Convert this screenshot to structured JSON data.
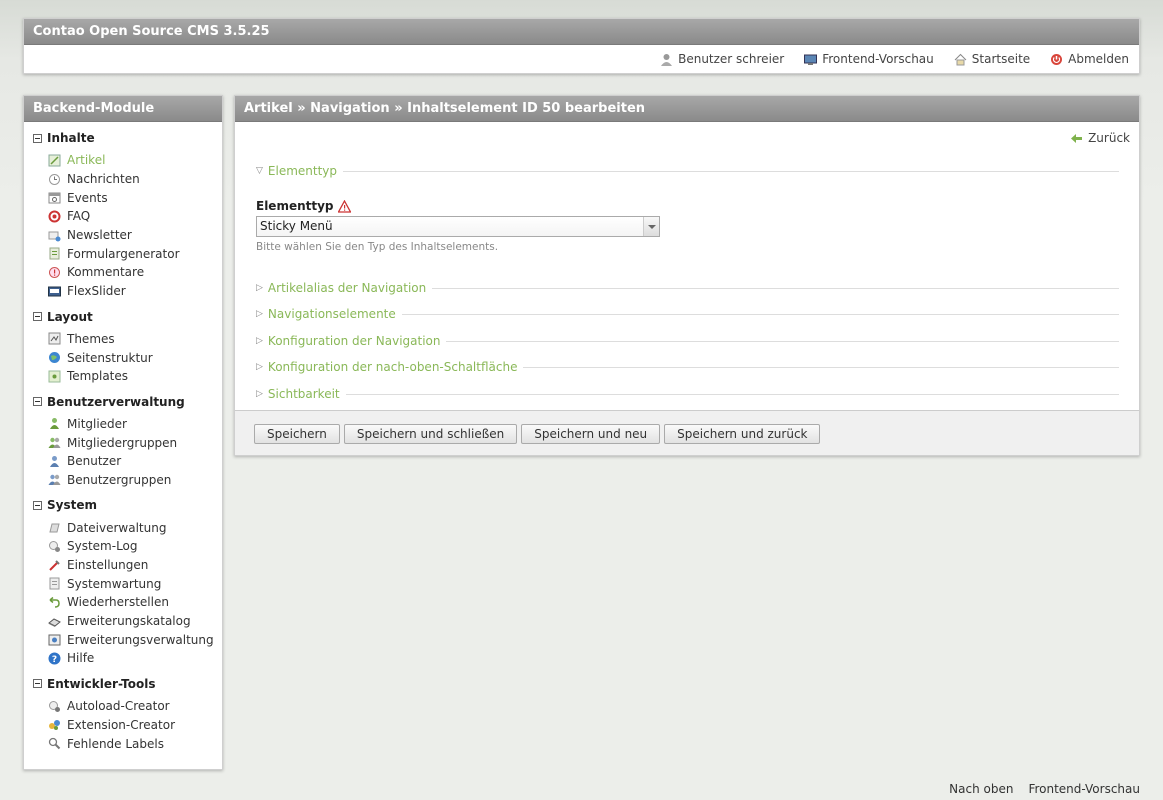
{
  "header": {
    "title": "Contao Open Source CMS 3.5.25",
    "nav": [
      {
        "label": "Benutzer schreier",
        "icon": "user-icon"
      },
      {
        "label": "Frontend-Vorschau",
        "icon": "monitor-icon"
      },
      {
        "label": "Startseite",
        "icon": "home-icon"
      },
      {
        "label": "Abmelden",
        "icon": "logout-icon"
      }
    ]
  },
  "sidebar": {
    "title": "Backend-Module",
    "groups": [
      {
        "title": "Inhalte",
        "items": [
          {
            "label": "Artikel",
            "icon": "article-icon",
            "active": true
          },
          {
            "label": "Nachrichten",
            "icon": "news-icon"
          },
          {
            "label": "Events",
            "icon": "calendar-icon"
          },
          {
            "label": "FAQ",
            "icon": "faq-icon"
          },
          {
            "label": "Newsletter",
            "icon": "newsletter-icon"
          },
          {
            "label": "Formulargenerator",
            "icon": "form-icon"
          },
          {
            "label": "Kommentare",
            "icon": "comment-icon"
          },
          {
            "label": "FlexSlider",
            "icon": "slider-icon"
          }
        ]
      },
      {
        "title": "Layout",
        "items": [
          {
            "label": "Themes",
            "icon": "themes-icon"
          },
          {
            "label": "Seitenstruktur",
            "icon": "globe-icon"
          },
          {
            "label": "Templates",
            "icon": "template-icon"
          }
        ]
      },
      {
        "title": "Benutzerverwaltung",
        "items": [
          {
            "label": "Mitglieder",
            "icon": "member-icon"
          },
          {
            "label": "Mitgliedergruppen",
            "icon": "member-group-icon"
          },
          {
            "label": "Benutzer",
            "icon": "user-icon"
          },
          {
            "label": "Benutzergruppen",
            "icon": "user-group-icon"
          }
        ]
      },
      {
        "title": "System",
        "items": [
          {
            "label": "Dateiverwaltung",
            "icon": "files-icon"
          },
          {
            "label": "System-Log",
            "icon": "log-icon"
          },
          {
            "label": "Einstellungen",
            "icon": "settings-icon"
          },
          {
            "label": "Systemwartung",
            "icon": "maintenance-icon"
          },
          {
            "label": "Wiederherstellen",
            "icon": "undo-icon"
          },
          {
            "label": "Erweiterungskatalog",
            "icon": "catalog-icon"
          },
          {
            "label": "Erweiterungsverwaltung",
            "icon": "extension-icon"
          },
          {
            "label": "Hilfe",
            "icon": "help-icon"
          }
        ]
      },
      {
        "title": "Entwickler-Tools",
        "items": [
          {
            "label": "Autoload-Creator",
            "icon": "autoload-icon"
          },
          {
            "label": "Extension-Creator",
            "icon": "extension-creator-icon"
          },
          {
            "label": "Fehlende Labels",
            "icon": "magnifier-icon"
          }
        ]
      }
    ]
  },
  "main": {
    "breadcrumb": "Artikel » Navigation » Inhaltselement ID 50 bearbeiten",
    "back_label": "Zurück",
    "legend_open": "Elementtyp",
    "field_label": "Elementtyp",
    "select_value": "Sticky Menü",
    "help_text": "Bitte wählen Sie den Typ des Inhaltselements.",
    "legends_closed": [
      "Artikelalias der Navigation",
      "Navigationselemente",
      "Konfiguration der Navigation",
      "Konfiguration der nach-oben-Schaltfläche",
      "Sichtbarkeit"
    ],
    "buttons": [
      "Speichern",
      "Speichern und schließen",
      "Speichern und neu",
      "Speichern und zurück"
    ]
  },
  "footer": {
    "top_link": "Nach oben",
    "preview_link": "Frontend-Vorschau"
  },
  "colors": {
    "accent_green": "#8ab858",
    "header_gray": "#999999"
  }
}
